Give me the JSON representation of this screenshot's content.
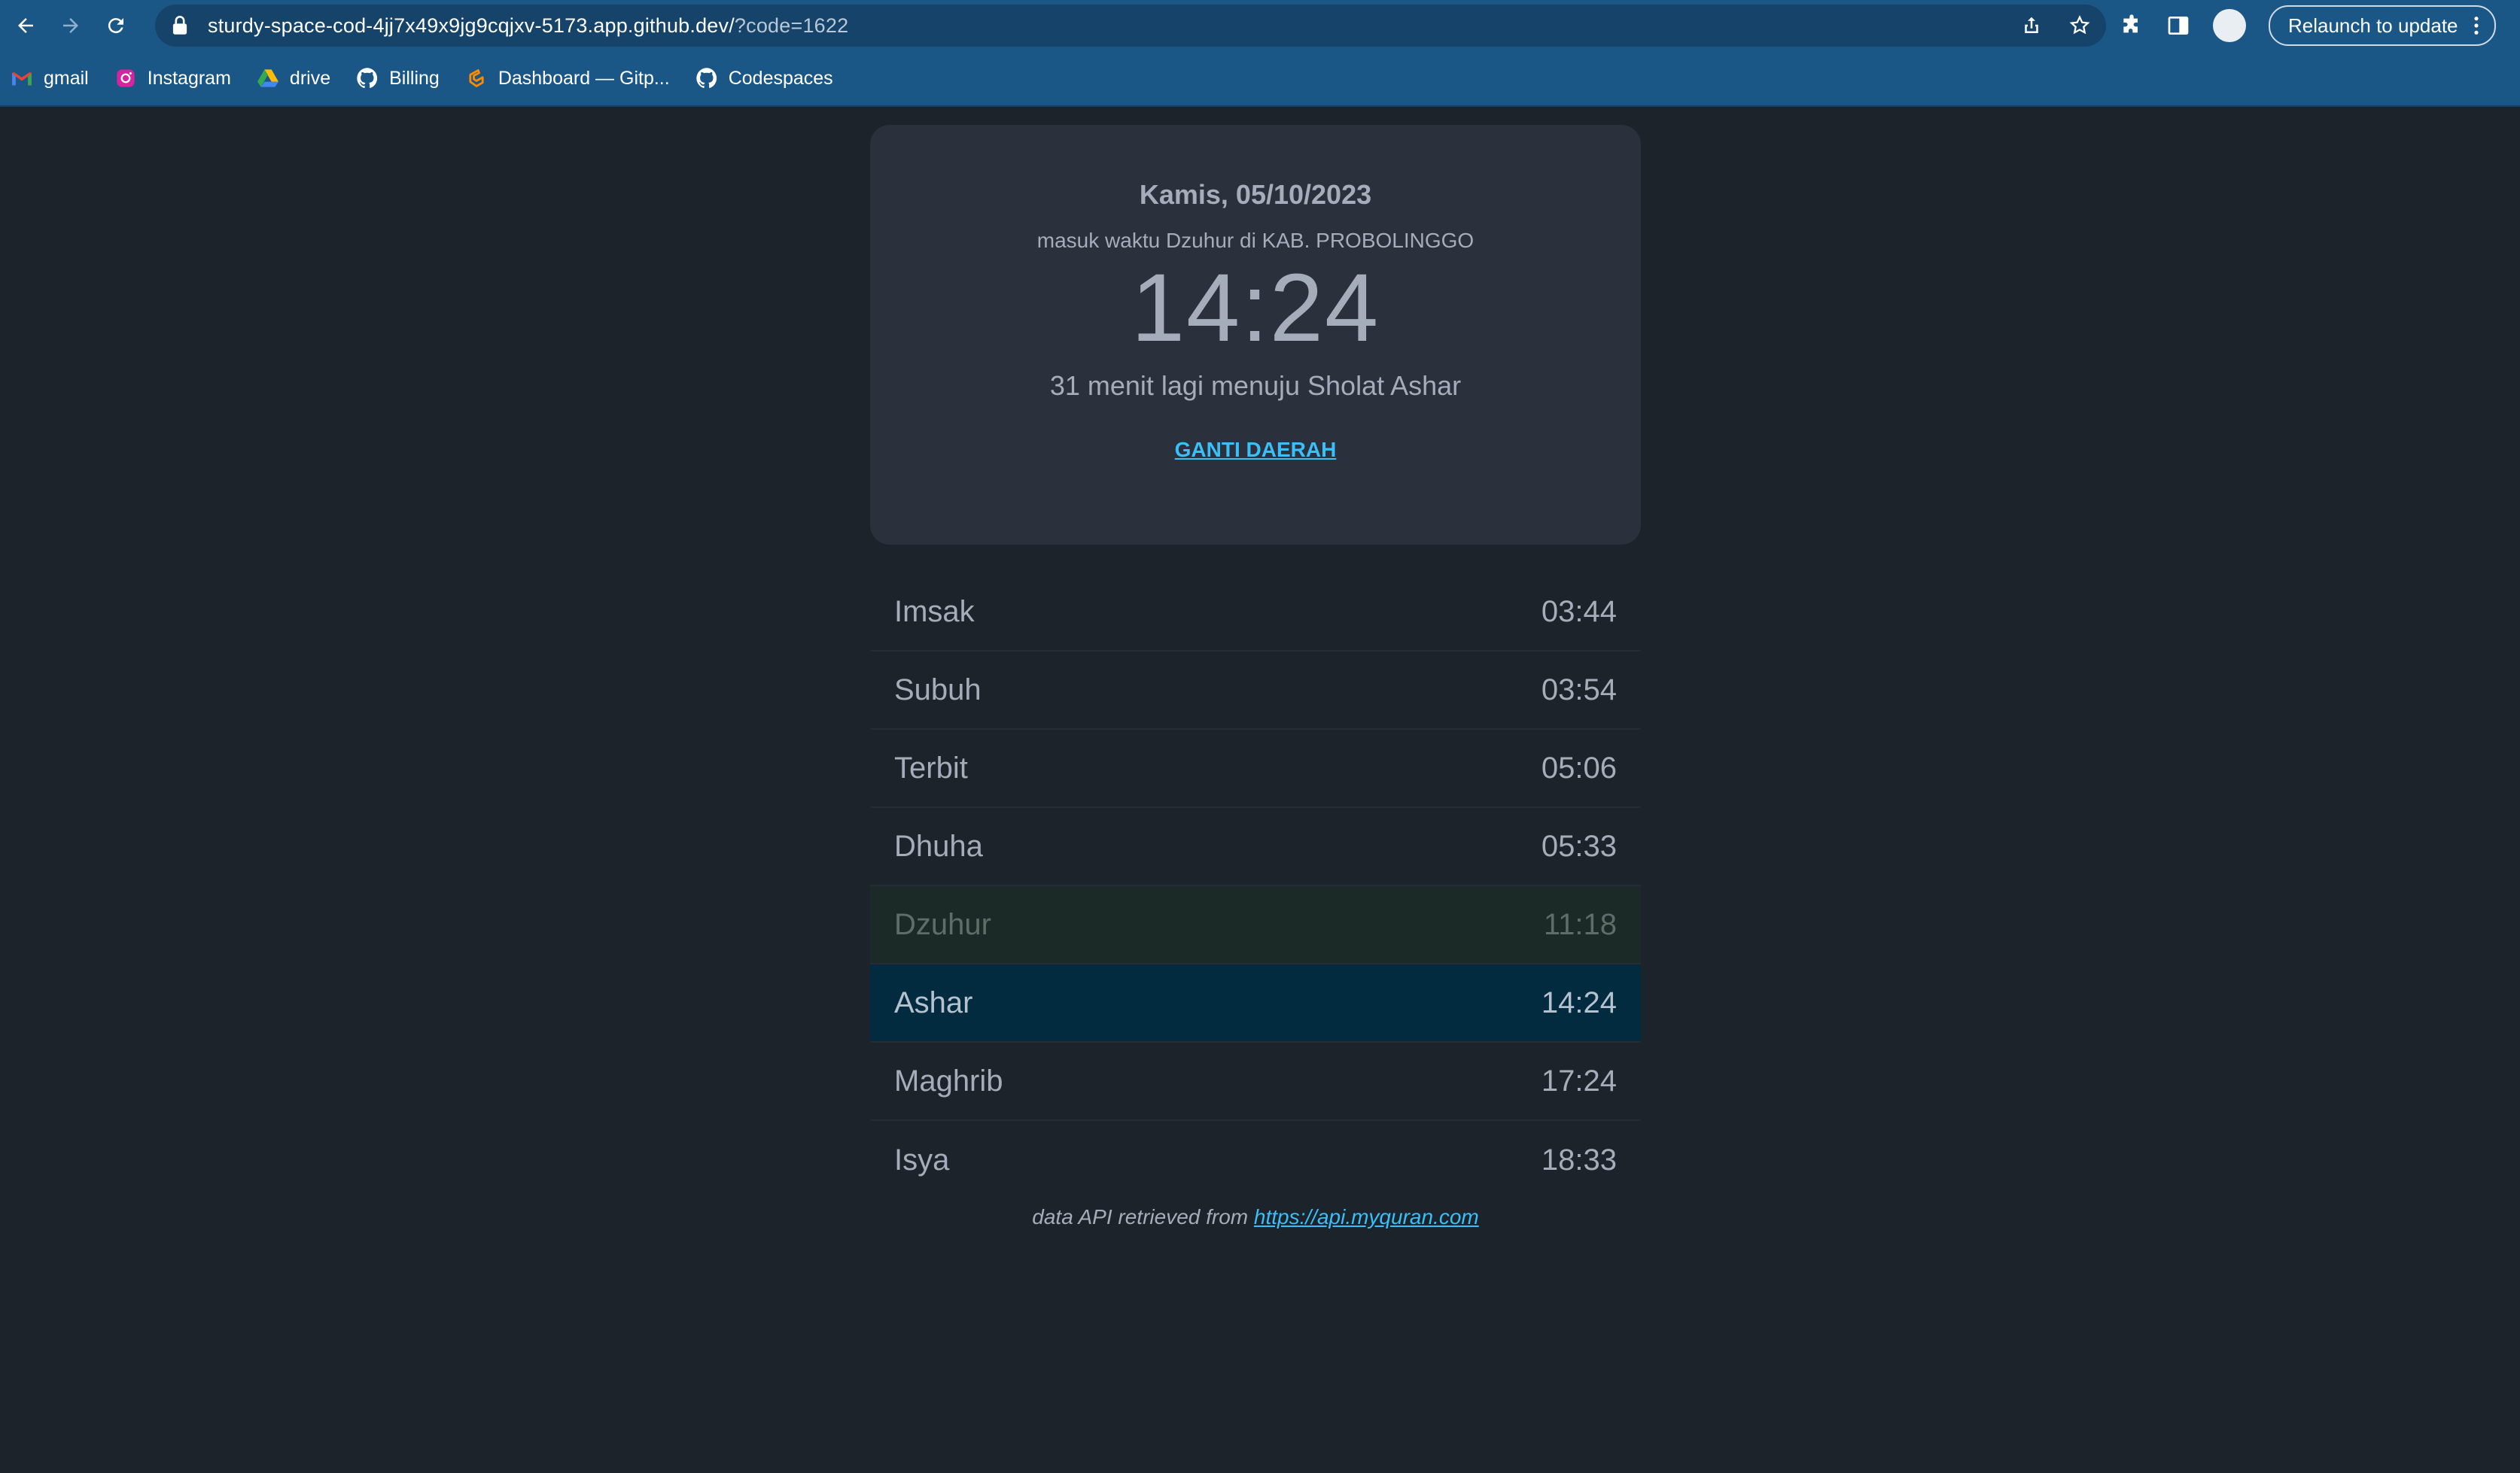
{
  "browser": {
    "url_host": "sturdy-space-cod-4jj7x49x9jg9cqjxv-5173.app.github.dev/",
    "url_query": "?code=1622",
    "relaunch_label": "Relaunch to update",
    "bookmarks": [
      {
        "label": "gmail",
        "icon": "gmail-icon"
      },
      {
        "label": "Instagram",
        "icon": "instagram-icon"
      },
      {
        "label": "drive",
        "icon": "drive-icon"
      },
      {
        "label": "Billing",
        "icon": "github-icon"
      },
      {
        "label": "Dashboard — Gitp...",
        "icon": "gitpod-icon"
      },
      {
        "label": "Codespaces",
        "icon": "github-icon"
      }
    ],
    "colors": {
      "chrome": "#1a5787",
      "omnibox": "#15436a"
    }
  },
  "card": {
    "date": "Kamis, 05/10/2023",
    "subtitle": "masuk waktu Dzuhur di KAB. PROBOLINGGO",
    "clock": "14:24",
    "remaining": "31 menit lagi menuju Sholat Ashar",
    "change_region_label": "GANTI DAERAH"
  },
  "schedule": [
    {
      "name": "Imsak",
      "time": "03:44",
      "state": "normal"
    },
    {
      "name": "Subuh",
      "time": "03:54",
      "state": "normal"
    },
    {
      "name": "Terbit",
      "time": "05:06",
      "state": "normal"
    },
    {
      "name": "Dhuha",
      "time": "05:33",
      "state": "normal"
    },
    {
      "name": "Dzuhur",
      "time": "11:18",
      "state": "passed"
    },
    {
      "name": "Ashar",
      "time": "14:24",
      "state": "next"
    },
    {
      "name": "Maghrib",
      "time": "17:24",
      "state": "normal"
    },
    {
      "name": "Isya",
      "time": "18:33",
      "state": "normal"
    }
  ],
  "footer": {
    "text": "data API retrieved from",
    "link": "https://api.myquran.com"
  },
  "theme": {
    "background": "#1d232a",
    "card": "#2a303c",
    "accent": "#3abff8"
  }
}
